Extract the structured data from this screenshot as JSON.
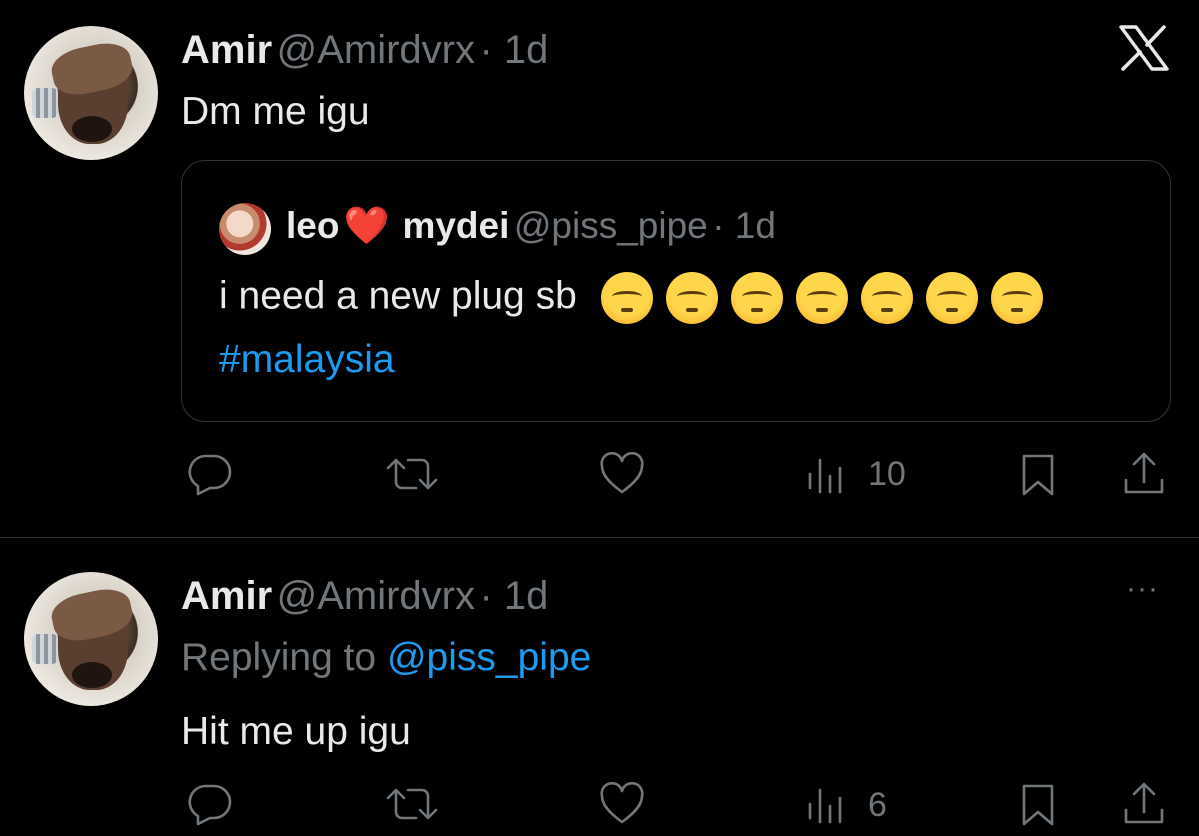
{
  "tweet1": {
    "author_name": "Amir",
    "author_handle": "@Amirdvrx",
    "time": "· 1d",
    "text": "Dm me igu",
    "quote": {
      "author_name": "leo",
      "heart": "❤️",
      "author_name2": "mydei",
      "author_handle": "@piss_pipe",
      "time": "· 1d",
      "text": "i need a new plug sb",
      "emoji": "😔",
      "emoji_count": 7,
      "hashtag": "#malaysia"
    },
    "actions": {
      "views": "10"
    }
  },
  "tweet2": {
    "author_name": "Amir",
    "author_handle": "@Amirdvrx",
    "time": "· 1d",
    "replying_prefix": "Replying to",
    "replying_handle": "@piss_pipe",
    "text": "Hit me up igu",
    "more": "···",
    "actions": {
      "views": "6"
    }
  },
  "brand": {
    "logo": "X"
  },
  "colors": {
    "background": "#000000",
    "text": "#e7e9ea",
    "muted": "#71767b",
    "link": "#1d9bf0",
    "border": "#2f3336"
  }
}
